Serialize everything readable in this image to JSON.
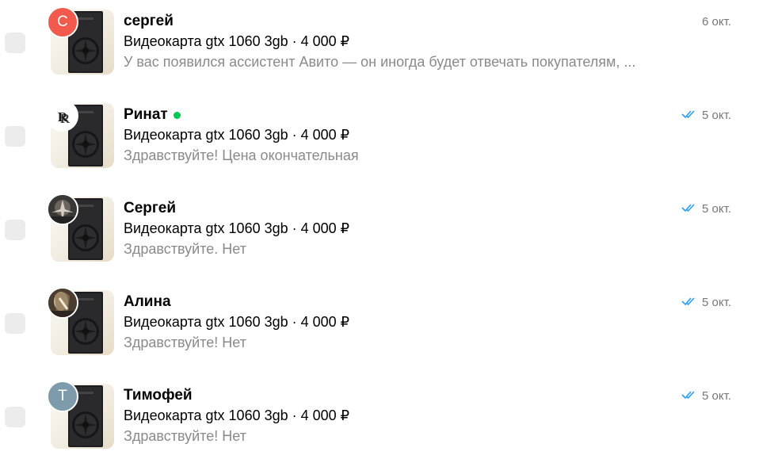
{
  "colors": {
    "checkbox": "#ececec",
    "online": "#00c853",
    "read_ticks": "#2a9df4",
    "preview_text": "#8a8a8a",
    "date_text": "#777777",
    "avatar_sergey": "#f25a4e",
    "avatar_timofey": "#7e9bab"
  },
  "chats": [
    {
      "name": "сергей",
      "avatar_type": "letter",
      "avatar_letter": "С",
      "online": false,
      "item": "Видеокарта gtx 1060 3gb · 4 000 ₽",
      "preview": "У вас появился ассистент Авито — он иногда будет отвечать покупателям, ...",
      "date": "6 окт.",
      "read": false
    },
    {
      "name": "Ринат",
      "avatar_type": "logo",
      "avatar_icon": "rolls-royce-logo-icon",
      "online": true,
      "item": "Видеокарта gtx 1060 3gb · 4 000 ₽",
      "preview": "Здравствуйте! Цена окончательная",
      "date": "5 окт.",
      "read": true
    },
    {
      "name": "Сергей",
      "avatar_type": "photo",
      "avatar_icon": "user-photo-icon",
      "online": false,
      "item": "Видеокарта gtx 1060 3gb · 4 000 ₽",
      "preview": "Здравствуйте. Нет",
      "date": "5 окт.",
      "read": true
    },
    {
      "name": "Алина",
      "avatar_type": "photo",
      "avatar_icon": "user-photo-icon",
      "online": false,
      "item": "Видеокарта gtx 1060 3gb · 4 000 ₽",
      "preview": "Здравствуйте! Нет",
      "date": "5 окт.",
      "read": true
    },
    {
      "name": "Тимофей",
      "avatar_type": "letter",
      "avatar_letter": "Т",
      "online": false,
      "item": "Видеокарта gtx 1060 3gb · 4 000 ₽",
      "preview": "Здравствуйте! Нет",
      "date": "5 окт.",
      "read": true
    }
  ]
}
